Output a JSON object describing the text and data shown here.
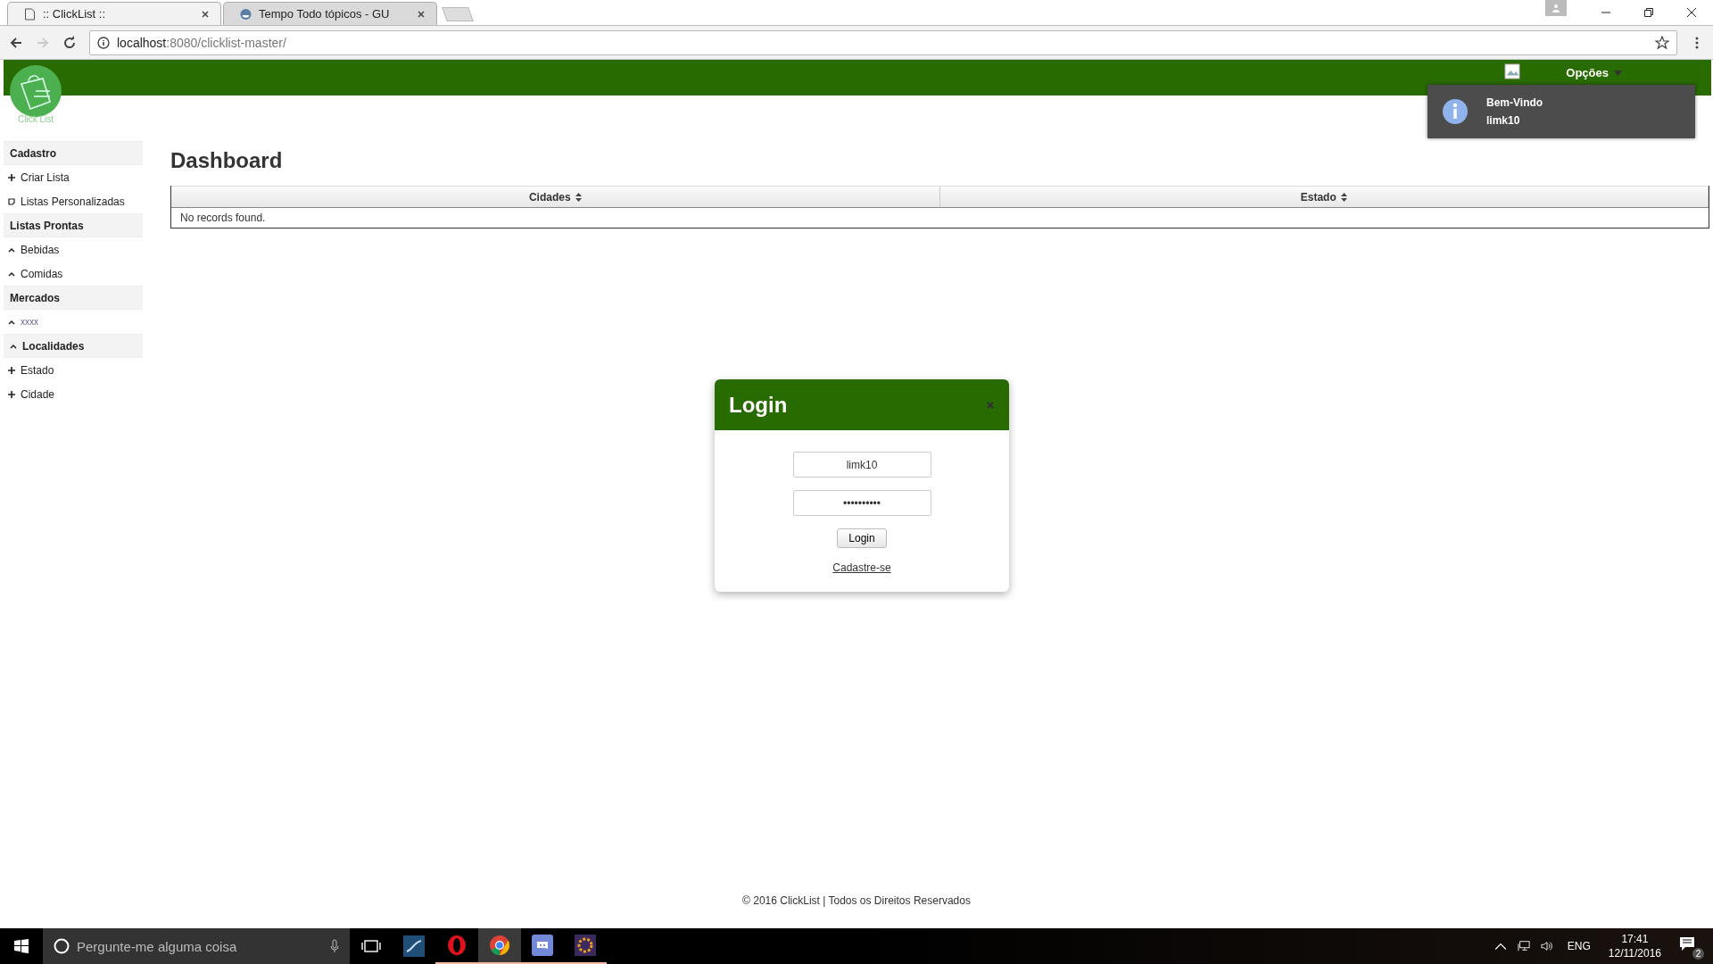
{
  "browser": {
    "tabs": [
      {
        "title": ":: ClickList ::",
        "kind": "page",
        "selected": true
      },
      {
        "title": "Tempo Todo tópicos - GU",
        "kind": "forum",
        "selected": false
      }
    ],
    "address": {
      "host": "localhost",
      "path": ":8080/clicklist-master/"
    }
  },
  "header": {
    "logo_text": "Click List",
    "menu": "Opções"
  },
  "notification": {
    "title": "Bem-Vindo",
    "message": "limk10"
  },
  "sidebar": [
    {
      "kind": "header",
      "label": "Cadastro"
    },
    {
      "kind": "add",
      "label": "Criar Lista"
    },
    {
      "kind": "note",
      "label": "Listas Personalizadas"
    },
    {
      "kind": "header",
      "label": "Listas Prontas"
    },
    {
      "kind": "expand",
      "label": "Bebidas"
    },
    {
      "kind": "expand",
      "label": "Comidas"
    },
    {
      "kind": "header",
      "label": "Mercados"
    },
    {
      "kind": "link",
      "label": "xxxx"
    },
    {
      "kind": "toggle",
      "label": "Localidades"
    },
    {
      "kind": "add",
      "label": "Estado"
    },
    {
      "kind": "add",
      "label": "Cidade"
    }
  ],
  "page_title": "Dashboard",
  "table": {
    "columns": [
      "Cidades",
      "Estado"
    ],
    "empty_message": "No records found."
  },
  "login_dialog": {
    "title": "Login",
    "username": "limk10",
    "password": "••••••••••",
    "button": "Login",
    "link": "Cadastre-se"
  },
  "footer": "© 2016 ClickList | Todos os Direitos Reservados",
  "taskbar": {
    "search_placeholder": "Pergunte-me alguma coisa",
    "apps": [
      {
        "kind": "database",
        "running": false,
        "selected": false
      },
      {
        "kind": "opera",
        "running": true,
        "selected": false
      },
      {
        "kind": "chrome",
        "running": true,
        "selected": true
      },
      {
        "kind": "discord",
        "running": true,
        "selected": false
      },
      {
        "kind": "ide",
        "running": true,
        "selected": false
      }
    ],
    "language": "ENG",
    "time": "17:41",
    "date": "12/11/2016",
    "notifications": "2"
  }
}
